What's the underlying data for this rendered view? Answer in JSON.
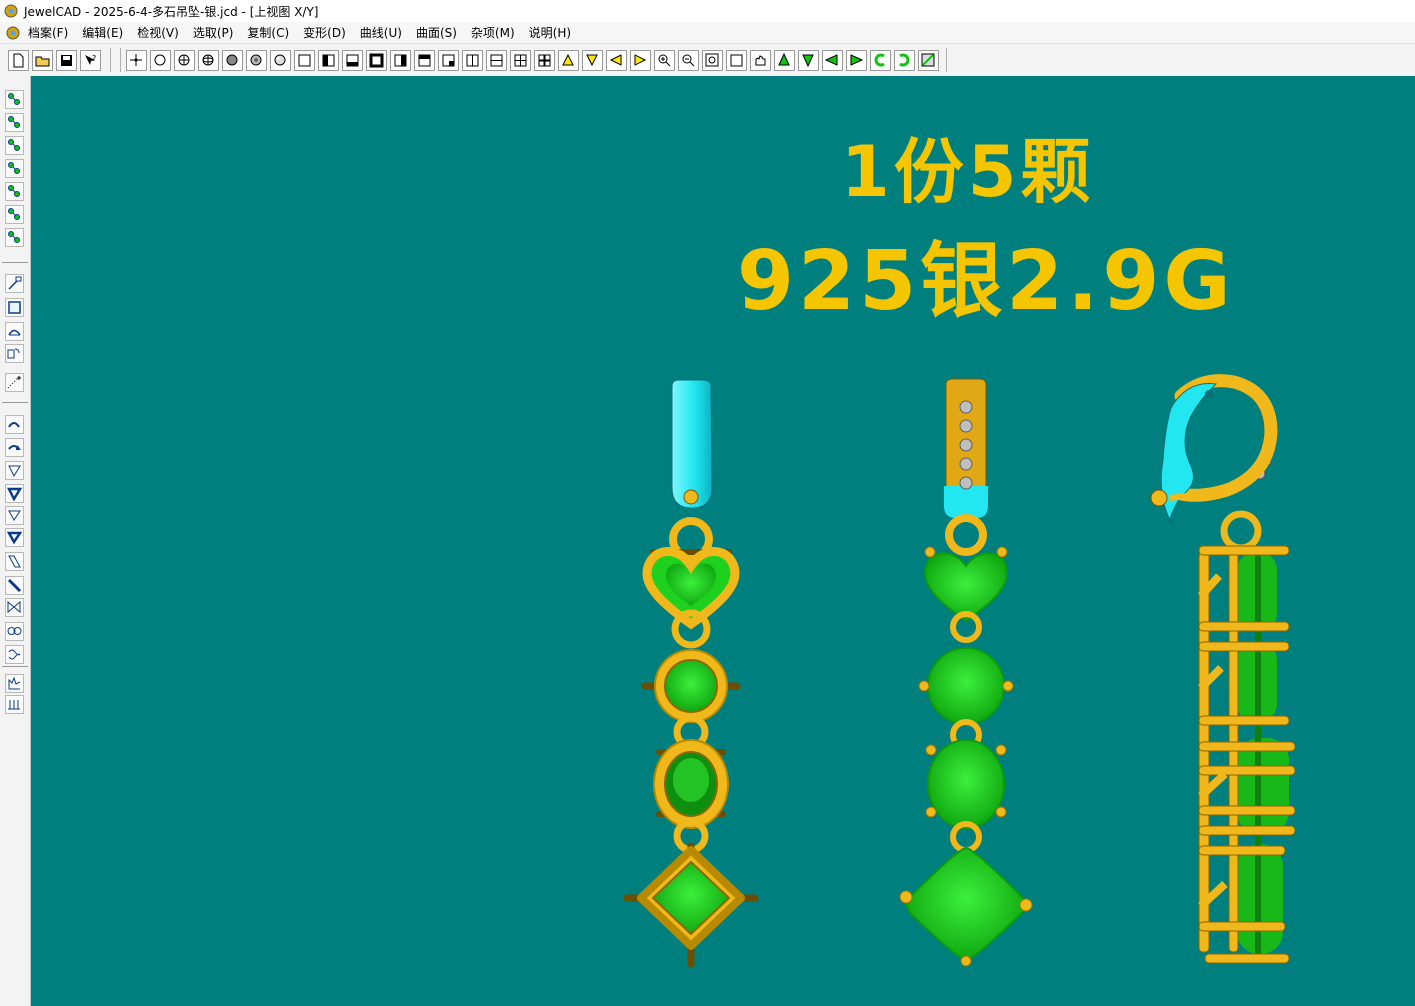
{
  "window": {
    "title": "JewelCAD - 2025-6-4-多石吊坠-银.jcd - [上视图 X/Y]"
  },
  "menu": {
    "items": [
      {
        "label": "档案(F)"
      },
      {
        "label": "编辑(E)"
      },
      {
        "label": "检视(V)"
      },
      {
        "label": "选取(P)"
      },
      {
        "label": "复制(C)"
      },
      {
        "label": "变形(D)"
      },
      {
        "label": "曲线(U)"
      },
      {
        "label": "曲面(S)"
      },
      {
        "label": "杂项(M)"
      },
      {
        "label": "说明(H)"
      }
    ]
  },
  "toolbar": {
    "buttons": [
      "new-file-icon",
      "open-folder-icon",
      "save-icon",
      "help-cursor-icon",
      "point-snap-icon",
      "circle-icon",
      "circle-cross-icon",
      "sphere-cross-icon",
      "solid-sphere-icon",
      "shaded-sphere-icon",
      "render-icon",
      "view-single-icon",
      "view-left-icon",
      "view-bottom-icon",
      "view-bold-icon",
      "view-right-icon",
      "view-top-icon",
      "view-bottom-right-icon",
      "view-vsplit-icon",
      "view-hsplit-icon",
      "view-quad-icon",
      "view-quad-bold-icon",
      "arrow-up-icon",
      "arrow-down-icon",
      "arrow-left-icon",
      "arrow-right-icon",
      "zoom-in-icon",
      "zoom-out-icon",
      "zoom-window-icon",
      "zoom-fit-icon",
      "pan-hand-icon",
      "rotate-up-icon",
      "rotate-down-icon",
      "rotate-left-icon",
      "rotate-right-icon",
      "rotate-ccw-icon",
      "rotate-cw-icon",
      "render-settings-icon"
    ]
  },
  "left_tools": {
    "buttons": [
      "select-arrow-icon",
      "select-pair-icon",
      "select-column-icon",
      "select-chain-icon",
      "select-grid-icon",
      "select-diagonal-icon",
      "select-ring-icon",
      "draw-line-icon",
      "draw-rect-icon",
      "draw-arc-icon",
      "copy-curve-icon",
      "add-point-icon",
      "surface-bend-icon",
      "surface-twist-icon",
      "surface-taper-icon",
      "surface-taper-bold-icon",
      "surface-invert-icon",
      "surface-invert-bold-icon",
      "surface-slant-icon",
      "surface-slant-bold-icon",
      "surface-bow-icon",
      "surface-loop-icon",
      "surface-wave-icon",
      "surface-spiral-icon",
      "surface-array-icon"
    ]
  },
  "viewport": {
    "background": "#007f7f",
    "headline_1": "1份5颗",
    "headline_2": "925银2.9G",
    "headline_color": "#f5c500",
    "gold_color": "#f0b81a",
    "gem_color": "#1fd11f",
    "highlight_color": "#22e6f0"
  }
}
